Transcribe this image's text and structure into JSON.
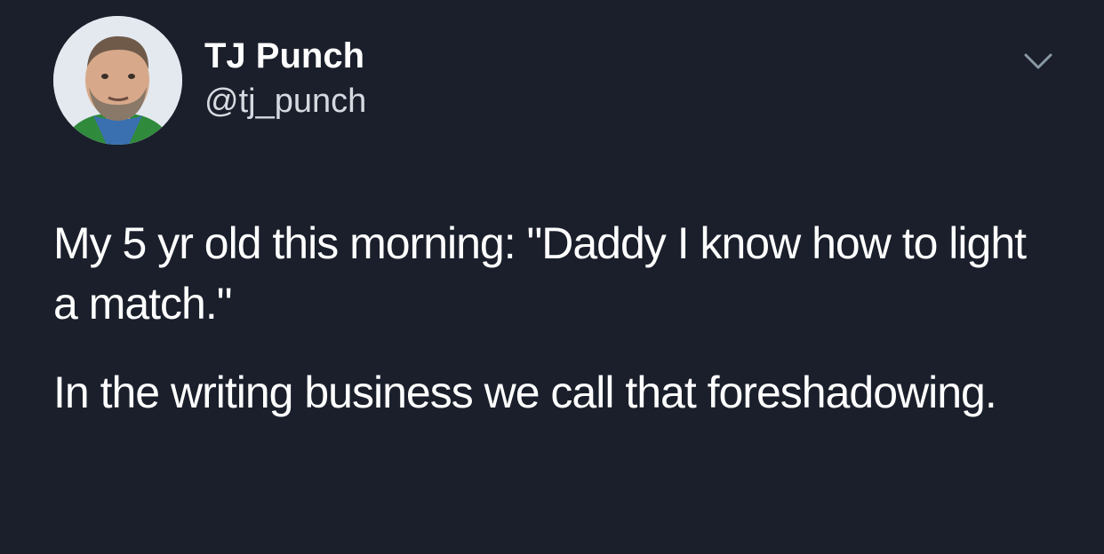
{
  "tweet": {
    "author": {
      "display_name": "TJ Punch",
      "handle": "@tj_punch",
      "avatar_icon": "profile-photo"
    },
    "menu_icon": "chevron-down-icon",
    "paragraphs": [
      "My 5 yr old this morning: \"Daddy I know how to light a match.\"",
      "In the writing business we call that foreshadowing."
    ]
  },
  "theme": {
    "background": "#1a1f2b",
    "text": "#ffffff",
    "secondary_text": "#d6dae0"
  }
}
